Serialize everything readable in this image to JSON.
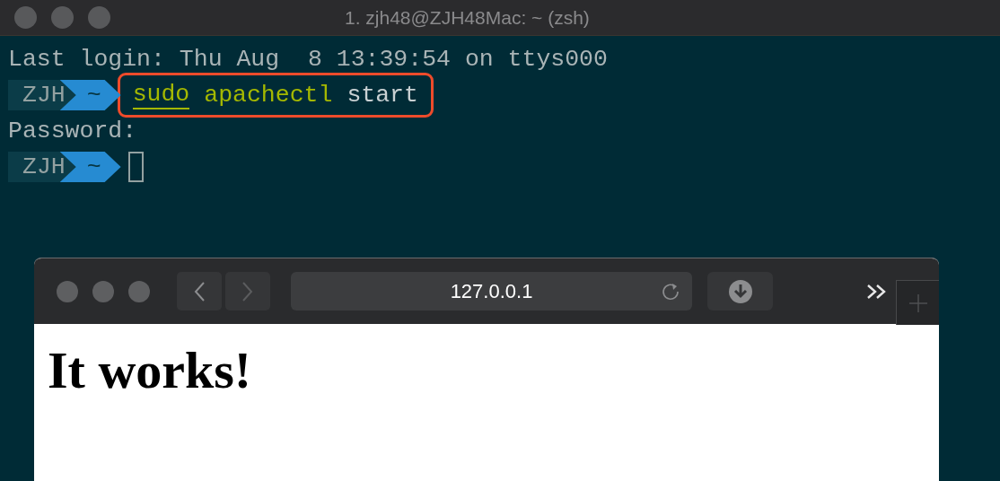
{
  "terminal": {
    "title": "1. zjh48@ZJH48Mac: ~ (zsh)",
    "lines": [
      {
        "kind": "output",
        "text": "Last login: Thu Aug  8 13:39:54 on ttys000"
      },
      {
        "kind": "prompt",
        "user": "ZJH",
        "dir": "~",
        "highlighted": true,
        "tokens": [
          {
            "text": "sudo",
            "color": "#a4b800",
            "underlined": true
          },
          {
            "text": "apachectl",
            "color": "#a4b800",
            "underlined": false
          },
          {
            "text": "start",
            "color": "#c9d1d3",
            "underlined": false
          }
        ],
        "cursor": false
      },
      {
        "kind": "output",
        "text": "Password:"
      },
      {
        "kind": "prompt",
        "user": "ZJH",
        "dir": "~",
        "cursor": true
      }
    ]
  },
  "browser": {
    "address": "127.0.0.1",
    "heading": "It works!"
  }
}
